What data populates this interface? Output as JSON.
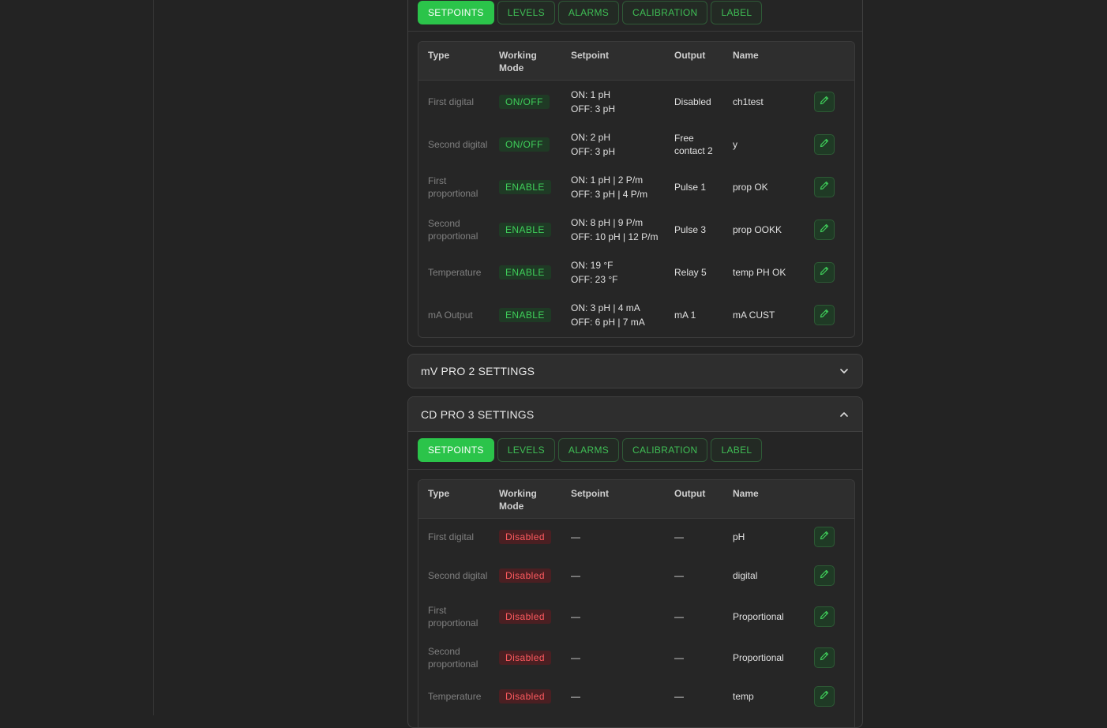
{
  "panel_top": {
    "tabs": [
      "SETPOINTS",
      "LEVELS",
      "ALARMS",
      "CALIBRATION",
      "LABEL"
    ],
    "active_tab": "SETPOINTS",
    "columns": {
      "type": "Type",
      "mode": "Working Mode",
      "setpoint": "Setpoint",
      "output": "Output",
      "name": "Name"
    },
    "rows": [
      {
        "type": "First digital",
        "mode": "ON/OFF",
        "sp_on": "ON: 1 pH",
        "sp_off": "OFF: 3 pH",
        "output": "Disabled",
        "name": "ch1test"
      },
      {
        "type": "Second digital",
        "mode": "ON/OFF",
        "sp_on": "ON: 2 pH",
        "sp_off": "OFF: 3 pH",
        "output": "Free contact 2",
        "name": "y"
      },
      {
        "type": "First proportional",
        "mode": "ENABLE",
        "sp_on": "ON: 1 pH | 2 P/m",
        "sp_off": "OFF: 3 pH | 4 P/m",
        "output": "Pulse 1",
        "name": "prop OK"
      },
      {
        "type": "Second proportional",
        "mode": "ENABLE",
        "sp_on": "ON: 8 pH | 9 P/m",
        "sp_off": "OFF: 10 pH | 12 P/m",
        "output": "Pulse 3",
        "name": "prop OOKK"
      },
      {
        "type": "Temperature",
        "mode": "ENABLE",
        "sp_on": "ON: 19 °F",
        "sp_off": "OFF: 23 °F",
        "output": "Relay 5",
        "name": "temp PH OK"
      },
      {
        "type": "mA Output",
        "mode": "ENABLE",
        "sp_on": "ON: 3 pH | 4 mA",
        "sp_off": "OFF: 6 pH | 7 mA",
        "output": "mA 1",
        "name": "mA CUST"
      }
    ]
  },
  "mv_section": {
    "title": "mV PRO 2 SETTINGS",
    "expanded": false
  },
  "cd_section": {
    "title": "CD PRO 3 SETTINGS",
    "expanded": true,
    "tabs": [
      "SETPOINTS",
      "LEVELS",
      "ALARMS",
      "CALIBRATION",
      "LABEL"
    ],
    "active_tab": "SETPOINTS",
    "columns": {
      "type": "Type",
      "mode": "Working Mode",
      "setpoint": "Setpoint",
      "output": "Output",
      "name": "Name"
    },
    "rows": [
      {
        "type": "First digital",
        "mode": "Disabled",
        "setpoint": "—",
        "output": "—",
        "name": "pH"
      },
      {
        "type": "Second digital",
        "mode": "Disabled",
        "setpoint": "—",
        "output": "—",
        "name": "digital"
      },
      {
        "type": "First proportional",
        "mode": "Disabled",
        "setpoint": "—",
        "output": "—",
        "name": "Proportional"
      },
      {
        "type": "Second proportional",
        "mode": "Disabled",
        "setpoint": "—",
        "output": "—",
        "name": "Proportional"
      },
      {
        "type": "Temperature",
        "mode": "Disabled",
        "setpoint": "—",
        "output": "—",
        "name": "temp"
      }
    ]
  },
  "colors": {
    "accent": "#2bc44a",
    "danger": "#ff5a5f",
    "background": "#232323"
  },
  "icons": {
    "edit": "pencil-icon",
    "collapse": "chevron-up-icon",
    "expand": "chevron-down-icon"
  }
}
